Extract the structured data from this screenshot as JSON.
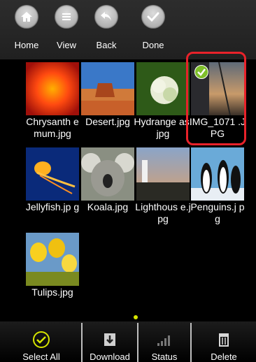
{
  "toolbar": {
    "home_label": "Home",
    "view_label": "View",
    "back_label": "Back",
    "done_label": "Done"
  },
  "photos": [
    {
      "name": "Chrysanth emum.jpg",
      "selected": false
    },
    {
      "name": "Desert.jpg",
      "selected": false
    },
    {
      "name": "Hydrange as.jpg",
      "selected": false
    },
    {
      "name": "IMG_1071 .JPG",
      "selected": true
    },
    {
      "name": "Jellyfish.jp g",
      "selected": false
    },
    {
      "name": "Koala.jpg",
      "selected": false
    },
    {
      "name": "Lighthous e.jpg",
      "selected": false
    },
    {
      "name": "Penguins.j pg",
      "selected": false
    },
    {
      "name": "Tulips.jpg",
      "selected": false
    }
  ],
  "bottombar": {
    "select_all_label": "Select All",
    "download_label": "Download",
    "status_label": "Status",
    "delete_label": "Delete"
  },
  "colors": {
    "selection_frame": "#e8222a",
    "check_badge": "#7fbf2a",
    "accent": "#d7e600"
  },
  "icons": {
    "home": "home-icon",
    "view": "list-icon",
    "back": "back-arrow-icon",
    "done": "checkmark-icon",
    "select_all": "circle-check-icon",
    "download": "download-icon",
    "status": "signal-bars-icon",
    "delete": "trash-icon"
  }
}
